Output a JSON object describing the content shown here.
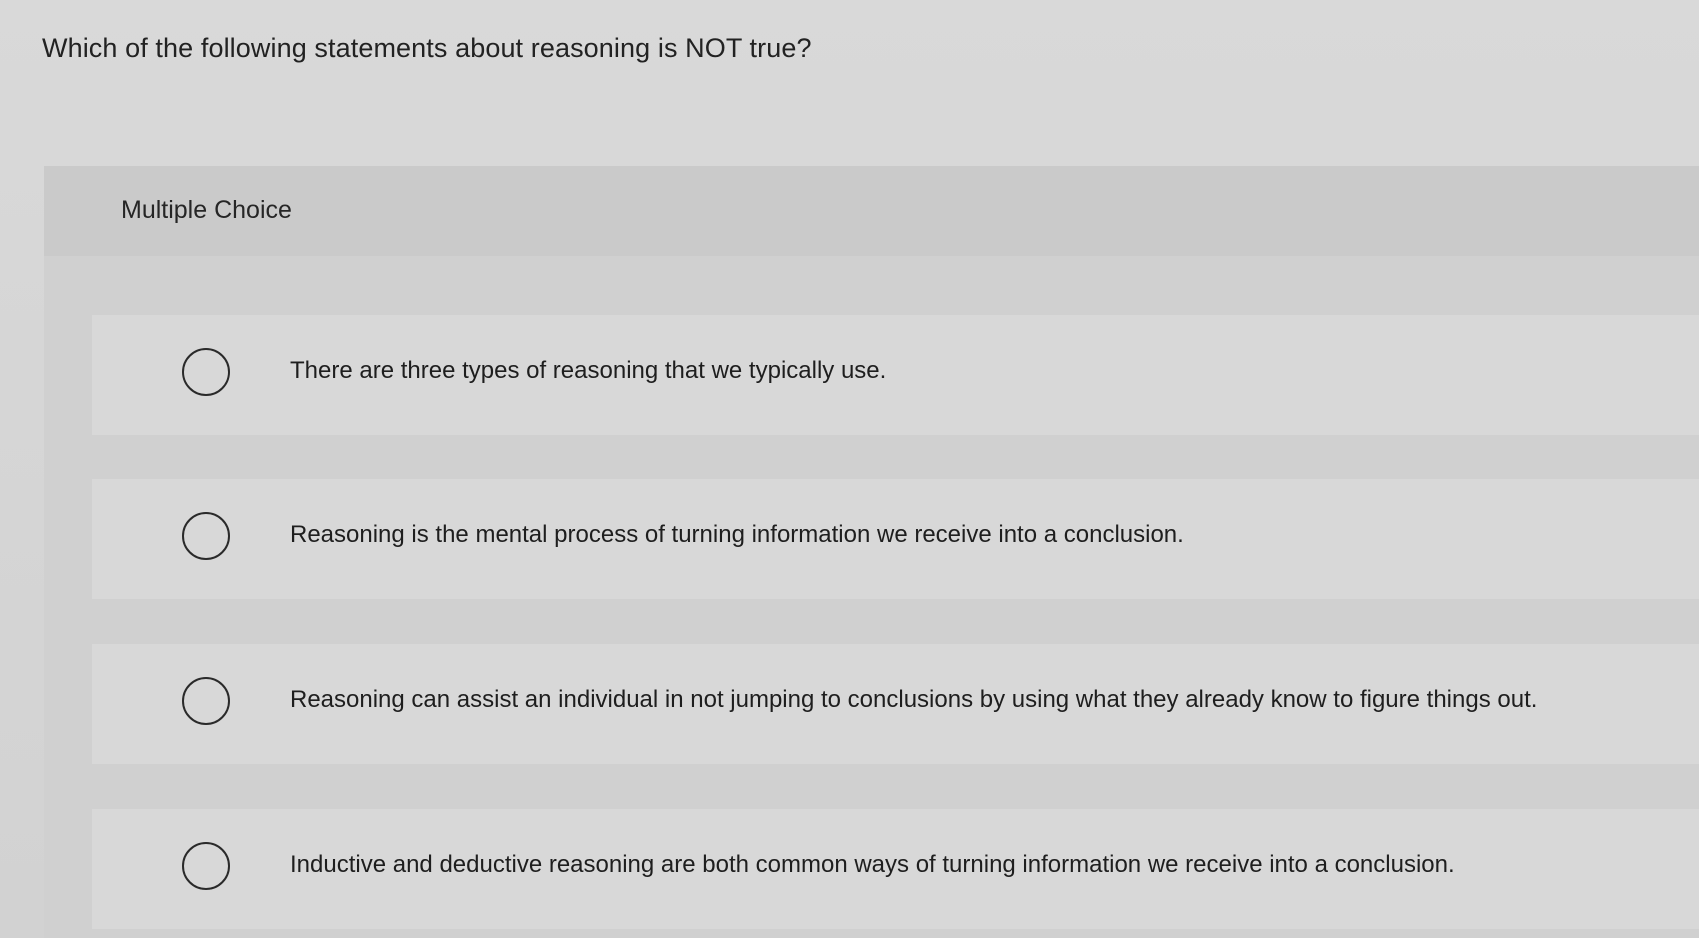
{
  "question": {
    "text": "Which of the following statements about reasoning is NOT true?"
  },
  "panel": {
    "header_label": "Multiple Choice"
  },
  "options": [
    {
      "label": "There are three types of reasoning that we typically use.",
      "selected": false
    },
    {
      "label": "Reasoning is the mental process of turning information we receive into a conclusion.",
      "selected": false
    },
    {
      "label": "Reasoning can assist an individual in not jumping to conclusions by using what they already know to figure things out.",
      "selected": false
    },
    {
      "label": "Inductive and deductive reasoning are both common ways of turning information we receive into a conclusion.",
      "selected": false
    }
  ]
}
